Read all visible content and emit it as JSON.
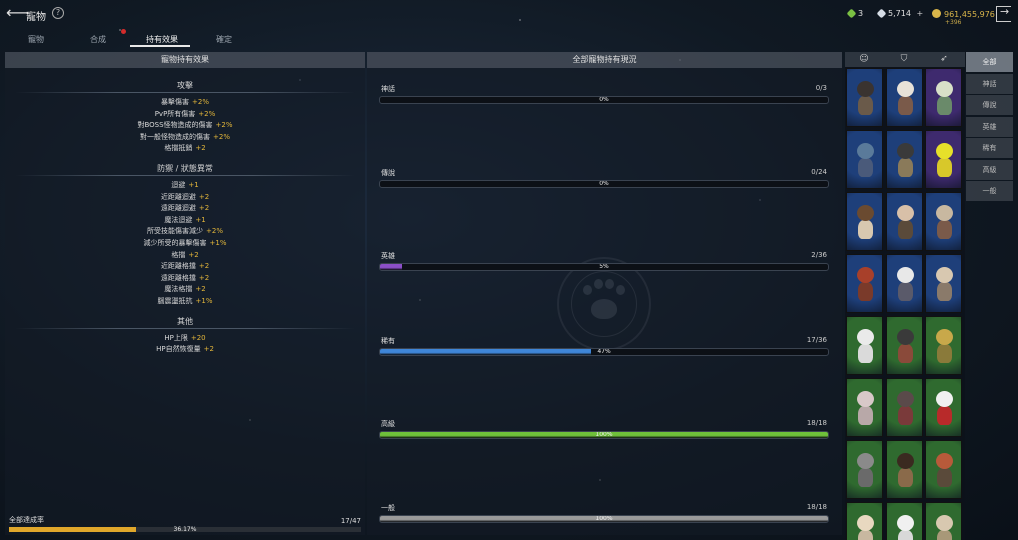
{
  "header": {
    "title": "寵物",
    "help_label": "?",
    "resources": [
      {
        "name": "ticket",
        "value": "3",
        "color": "#7ac043"
      },
      {
        "name": "diamond",
        "value": "5,714",
        "color": "#d6dde6"
      },
      {
        "name": "gold",
        "value": "961,455,976",
        "color": "#d9b54a"
      }
    ],
    "gold_bonus": "+396",
    "add_label": "+"
  },
  "tabs": [
    {
      "label": "寵物",
      "active": false
    },
    {
      "label": "合成",
      "active": false
    },
    {
      "label": "持有效果",
      "active": true
    },
    {
      "label": "確定",
      "active": false
    }
  ],
  "left_panel": {
    "title": "寵物持有效果",
    "groups": [
      {
        "name": "攻擊",
        "effects": [
          {
            "label": "暴擊傷害",
            "value": "+2%"
          },
          {
            "label": "PvP所有傷害",
            "value": "+2%"
          },
          {
            "label": "對BOSS怪物造成的傷害",
            "value": "+2%"
          },
          {
            "label": "對一般怪物造成的傷害",
            "value": "+2%"
          },
          {
            "label": "格擋抵銷",
            "value": "+2"
          }
        ]
      },
      {
        "name": "防禦 / 狀態異常",
        "effects": [
          {
            "label": "迴避",
            "value": "+1"
          },
          {
            "label": "近距離迴避",
            "value": "+2"
          },
          {
            "label": "遠距離迴避",
            "value": "+2"
          },
          {
            "label": "魔法迴避",
            "value": "+1"
          },
          {
            "label": "所受技能傷害減少",
            "value": "+2%"
          },
          {
            "label": "減少所受的暴擊傷害",
            "value": "+1%"
          },
          {
            "label": "格擋",
            "value": "+2"
          },
          {
            "label": "近距離格擋",
            "value": "+2"
          },
          {
            "label": "遠距離格擋",
            "value": "+2"
          },
          {
            "label": "魔法格擋",
            "value": "+2"
          },
          {
            "label": "腦震盪抵抗",
            "value": "+1%"
          }
        ]
      },
      {
        "name": "其他",
        "effects": [
          {
            "label": "HP上限",
            "value": "+20"
          },
          {
            "label": "HP自然恢復量",
            "value": "+2"
          }
        ]
      }
    ],
    "total": {
      "label": "全部達成率",
      "count": "17/47",
      "percent": "36.17%",
      "fraction": 0.3617
    }
  },
  "mid_panel": {
    "title": "全部寵物持有現況",
    "rarities": [
      {
        "name": "神話",
        "count": "0/3",
        "percent": "0%",
        "fraction": 0,
        "color": "#888888"
      },
      {
        "name": "傳說",
        "count": "0/24",
        "percent": "0%",
        "fraction": 0,
        "color": "#c58b2a"
      },
      {
        "name": "英雄",
        "count": "2/36",
        "percent": "5%",
        "fraction": 0.05,
        "color": "#8b4fc9"
      },
      {
        "name": "稀有",
        "count": "17/36",
        "percent": "47%",
        "fraction": 0.47,
        "color": "#3f86d8"
      },
      {
        "name": "高級",
        "count": "18/18",
        "percent": "100%",
        "fraction": 1,
        "color": "#6fc13a"
      },
      {
        "name": "一般",
        "count": "18/18",
        "percent": "100%",
        "fraction": 1,
        "color": "#9a9a9a"
      }
    ]
  },
  "pet_grid": {
    "header_icons": [
      "pet-face-icon",
      "shield-icon",
      "bow-icon"
    ],
    "cells": [
      {
        "bg": "#1e3f7a",
        "head": "#3a3330",
        "body": "#6a5a4a"
      },
      {
        "bg": "#1e3f7a",
        "head": "#e8e2d8",
        "body": "#7a5a4a"
      },
      {
        "bg": "#3e2a6e",
        "head": "#d8e0c8",
        "body": "#6a8a6a"
      },
      {
        "bg": "#1e3f7a",
        "head": "#5a7a9a",
        "body": "#4a5a7a"
      },
      {
        "bg": "#1e3f7a",
        "head": "#3a3a3a",
        "body": "#8a7a5a"
      },
      {
        "bg": "#3e2a6e",
        "head": "#e6e02a",
        "body": "#d8c82a"
      },
      {
        "bg": "#1e3f7a",
        "head": "#6a4a30",
        "body": "#d8c8b0"
      },
      {
        "bg": "#1e3f7a",
        "head": "#d8c0a8",
        "body": "#5a4a3a"
      },
      {
        "bg": "#1e3f7a",
        "head": "#c8b8a0",
        "body": "#7a5a4a"
      },
      {
        "bg": "#1e3f7a",
        "head": "#a8402a",
        "body": "#7a3a2a"
      },
      {
        "bg": "#1e3f7a",
        "head": "#e8e8e8",
        "body": "#5a5a6a"
      },
      {
        "bg": "#1e3f7a",
        "head": "#d8c8b0",
        "body": "#8a7a6a"
      },
      {
        "bg": "#2f6a2f",
        "head": "#eaeaea",
        "body": "#dadada"
      },
      {
        "bg": "#2f6a2f",
        "head": "#3a3a3a",
        "body": "#8a4a3a"
      },
      {
        "bg": "#2f6a2f",
        "head": "#c8a84a",
        "body": "#8a7a3a"
      },
      {
        "bg": "#2f6a2f",
        "head": "#d8c8c8",
        "body": "#b8a8a8"
      },
      {
        "bg": "#2f6a2f",
        "head": "#5a4a4a",
        "body": "#7a3a3a"
      },
      {
        "bg": "#2f6a2f",
        "head": "#f0f0f0",
        "body": "#b82a2a"
      },
      {
        "bg": "#2f6a2f",
        "head": "#8a8a8a",
        "body": "#6a6a6a"
      },
      {
        "bg": "#2f6a2f",
        "head": "#3a2a20",
        "body": "#8a6a4a"
      },
      {
        "bg": "#2f6a2f",
        "head": "#b85a3a",
        "body": "#5a4a3a"
      },
      {
        "bg": "#2f6a2f",
        "head": "#e8d8c0",
        "body": "#c8b8a0"
      },
      {
        "bg": "#2f6a2f",
        "head": "#f0f0f0",
        "body": "#d8d8d8"
      },
      {
        "bg": "#2f6a2f",
        "head": "#d8c8b0",
        "body": "#a89878"
      }
    ]
  },
  "filters": [
    {
      "label": "全部",
      "active": true
    },
    {
      "label": "神話",
      "active": false
    },
    {
      "label": "傳說",
      "active": false
    },
    {
      "label": "英雄",
      "active": false
    },
    {
      "label": "稀有",
      "active": false
    },
    {
      "label": "高級",
      "active": false
    },
    {
      "label": "一般",
      "active": false
    }
  ]
}
